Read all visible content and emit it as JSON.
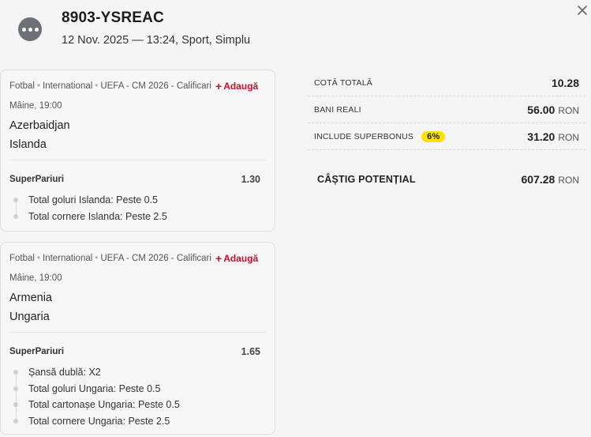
{
  "header": {
    "ticket_id": "8903-YSREAC",
    "subtitle": "12 Nov. 2025 — 13:24, Sport, Simplu",
    "menu_icon": "more-dots-icon",
    "close_icon": "close-icon"
  },
  "bets": [
    {
      "sport": "Fotbal",
      "category": "International",
      "competition": "UEFA - CM 2026 - Calificari",
      "add_label": "Adaugă",
      "time": "Mâine, 19:00",
      "team_home": "Azerbaidjan",
      "team_away": "Islanda",
      "market": "SuperPariuri",
      "odds": "1.30",
      "selections": [
        "Total goluri Islanda: Peste 0.5",
        "Total cornere Islanda: Peste 2.5"
      ]
    },
    {
      "sport": "Fotbal",
      "category": "International",
      "competition": "UEFA - CM 2026 - Calificari",
      "add_label": "Adaugă",
      "time": "Mâine, 19:00",
      "team_home": "Armenia",
      "team_away": "Ungaria",
      "market": "SuperPariuri",
      "odds": "1.65",
      "selections": [
        "Șansă dublă: X2",
        "Total goluri Ungaria: Peste 0.5",
        "Total cartonașe Ungaria: Peste 0.5",
        "Total cornere Ungaria: Peste 2.5"
      ]
    }
  ],
  "summary": {
    "total_odds_label": "COTĂ TOTALĂ",
    "total_odds": "10.28",
    "stake_label": "BANI REALI",
    "stake": "56.00",
    "superbonus_label": "INCLUDE SUPERBONUS",
    "superbonus_pct": "6%",
    "superbonus_value": "31.20",
    "currency": "RON",
    "win_label": "CÂȘTIG POTENȚIAL",
    "win_value": "607.28"
  },
  "colors": {
    "accent_red": "#c8102e",
    "badge_yellow": "#ffe100",
    "menu_grey": "#6e7077"
  }
}
